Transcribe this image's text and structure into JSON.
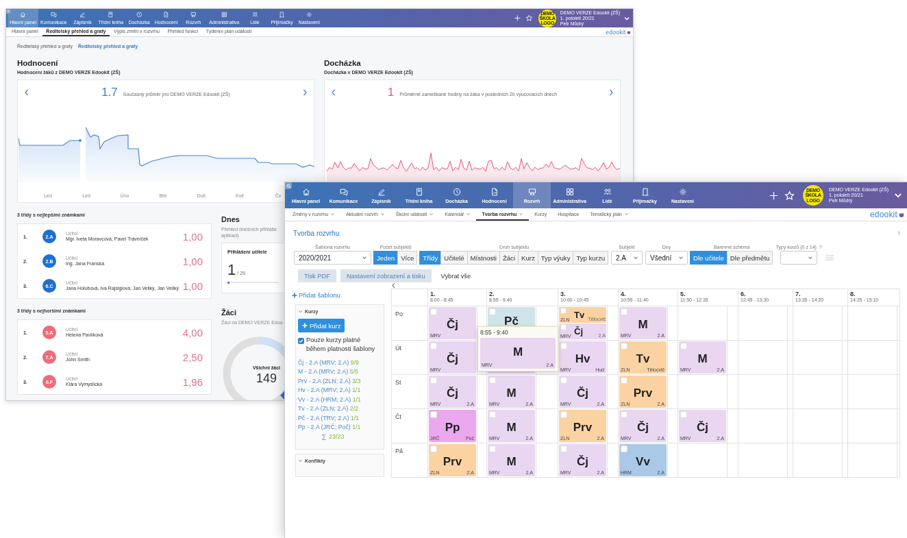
{
  "back_window": {
    "nav": {
      "items": [
        {
          "label": "Hlavní panel",
          "selected": true
        },
        {
          "label": "Komunikace",
          "selected": false
        },
        {
          "label": "Zápisník",
          "selected": false
        },
        {
          "label": "Třídní kniha",
          "selected": false
        },
        {
          "label": "Docházka",
          "selected": false
        },
        {
          "label": "Hodnocení",
          "selected": false
        },
        {
          "label": "Rozvrh",
          "selected": false
        },
        {
          "label": "Administrativa",
          "selected": false
        },
        {
          "label": "Lidé",
          "selected": false
        },
        {
          "label": "Přijímačky",
          "selected": false
        },
        {
          "label": "Nastavení",
          "selected": false
        }
      ],
      "logo": "DEMO ŠKOLA LOGO",
      "account": {
        "school": "DEMO VERZE Edookit (ZŠ)",
        "term": "1. pololetí 20/21",
        "user": "Petr Můdrý"
      }
    },
    "subnav": [
      {
        "label": "Hlavní panel",
        "selected": false
      },
      {
        "label": "Ředitelský přehled a grafy",
        "selected": true
      },
      {
        "label": "Výpis změn v rozvrhu",
        "selected": false
      },
      {
        "label": "Přehled funkcí",
        "selected": false
      },
      {
        "label": "Týdenní plán událostí",
        "selected": false
      }
    ],
    "brand": "edookit",
    "breadcrumb": [
      "Ředitelský přehled a grafy",
      "Ředitelský přehled a grafy"
    ],
    "grades": {
      "title": "Hodnocení",
      "subtitle": "Hodnocení žáků z DEMO VERZE Edookit (ZŠ)",
      "value": "1.7",
      "caption": "Současný průměr pro DEMO VERZE Edookit (ZŠ)",
      "month_labels": [
        "Led",
        "Led",
        "Úno",
        "Bře",
        "Dub",
        "Kvě",
        "Čv"
      ]
    },
    "attendance": {
      "title": "Docházka",
      "subtitle": "Docházka v DEMO VERZE Edookit (ZŠ)",
      "value": "1",
      "caption": "Průměrné zameškané hodiny na žáka v posledních 20 vyučovacích dnech"
    },
    "rankings": [
      {
        "kind": "best",
        "title": "3 třídy s nejlepšími známkami",
        "rows": [
          {
            "rank": "1.",
            "class": "2.A",
            "role": "Učitel",
            "teachers": "Mgr. Iveta Moravcová, Pavel Trávníček",
            "average": "1,00"
          },
          {
            "rank": "2.",
            "class": "2.B",
            "role": "Učitel",
            "teachers": "Ing. Jana Franská",
            "average": "1,00"
          },
          {
            "rank": "3.",
            "class": "6.C",
            "role": "Učitel",
            "teachers": "Jana Holubová, Iva Rajsiglová, Jan Veliký, Jan Veliký",
            "average": "1,00"
          }
        ]
      },
      {
        "kind": "worst",
        "title": "3 třídy s nejhoršími známkami",
        "rows": [
          {
            "rank": "1.",
            "class": "5.A",
            "role": "Učitel",
            "teachers": "Helena Pavlíková",
            "average": "4,00"
          },
          {
            "rank": "2.",
            "class": "7.A",
            "role": "Učitel",
            "teachers": "John Smith",
            "average": "2,50"
          },
          {
            "rank": "3.",
            "class": "6.F",
            "role": "Učitel",
            "teachers": "Klára Vymyslická",
            "average": "1,96"
          }
        ]
      }
    ],
    "today": {
      "title": "Dnes",
      "description": [
        "Přehled dnešních přihláše",
        "aplikaci)"
      ],
      "card": {
        "title": "Přihlášení učitelé",
        "value": "1",
        "total": "/ 29",
        "level": 0.04
      }
    },
    "students": {
      "title": "Žáci",
      "description": "Žáci na DEMO VERZE Edoo",
      "total_label": "Všichni žáci",
      "total": "149"
    }
  },
  "front_window": {
    "nav": {
      "items": [
        {
          "label": "Hlavní panel",
          "selected": false
        },
        {
          "label": "Komunikace",
          "selected": false
        },
        {
          "label": "Zápisník",
          "selected": false
        },
        {
          "label": "Třídní kniha",
          "selected": false
        },
        {
          "label": "Docházka",
          "selected": false
        },
        {
          "label": "Hodnocení",
          "selected": false
        },
        {
          "label": "Rozvrh",
          "selected": true
        },
        {
          "label": "Administrativa",
          "selected": false
        },
        {
          "label": "Lidé",
          "selected": false
        },
        {
          "label": "Přijímačky",
          "selected": false
        },
        {
          "label": "Nastavení",
          "selected": false
        }
      ],
      "logo": "DEMO ŠKOLA LOGO",
      "account": {
        "school": "DEMO VERZE Edookit (ZŠ)",
        "term": "1. pololetí 20/21",
        "user": "Petr Můdrý"
      }
    },
    "subnav": [
      {
        "label": "Změny v rozvrhu",
        "selected": false,
        "menu": true
      },
      {
        "label": "Aktuální rozvrh",
        "selected": false,
        "menu": true
      },
      {
        "label": "Školní události",
        "selected": false,
        "menu": true
      },
      {
        "label": "Kalendář",
        "selected": false,
        "menu": true
      },
      {
        "label": "Tvorba rozvrhu",
        "selected": true,
        "menu": true
      },
      {
        "label": "Kurzy",
        "selected": false,
        "menu": false
      },
      {
        "label": "Hospitace",
        "selected": false,
        "menu": false
      },
      {
        "label": "Tematický plán",
        "selected": false,
        "menu": true
      }
    ],
    "brand": "edookit",
    "title": "Tvorba rozvrhu",
    "help": "?",
    "toolbar": [
      {
        "kind": "select",
        "label": "Šablona rozvrhu",
        "value": "2020/2021"
      },
      {
        "kind": "toggle",
        "label": "Počet subjektů",
        "options": [
          {
            "label": "Jeden",
            "selected": true
          },
          {
            "label": "Více",
            "selected": false
          }
        ]
      },
      {
        "kind": "toggle",
        "label": "Druh subjektu",
        "options": [
          {
            "label": "Třídy",
            "selected": true
          },
          {
            "label": "Učitelé",
            "selected": false
          },
          {
            "label": "Místnosti",
            "selected": false
          },
          {
            "label": "Žáci",
            "selected": false
          },
          {
            "label": "Kurz",
            "selected": false
          },
          {
            "label": "Typ výuky",
            "selected": false
          },
          {
            "label": "Typ kurzu",
            "selected": false
          }
        ]
      },
      {
        "kind": "select",
        "label": "Subjekt",
        "value": "2.A"
      },
      {
        "kind": "select",
        "label": "Dny",
        "value": "Všední"
      },
      {
        "kind": "toggle",
        "label": "Barevné schéma",
        "options": [
          {
            "label": "Dle učitele",
            "selected": true
          },
          {
            "label": "Dle předmětu",
            "selected": false
          }
        ]
      },
      {
        "kind": "select",
        "label": "Typy kurzů (0 z 14)",
        "help": "?"
      }
    ],
    "actions": [
      {
        "kind": "button",
        "label": "Tisk PDF"
      },
      {
        "kind": "button",
        "label": "Nastavení zobrazení a tisku"
      },
      {
        "kind": "link",
        "label": "Vybrat vše"
      }
    ],
    "side": {
      "add_template": "Přidat šablonu",
      "courses_title": "Kurzy",
      "add_course": "Přidat kurz",
      "filter": {
        "label": "Pouze kurzy platné během platnosti šablony",
        "checked": true
      },
      "courses": [
        {
          "name": "Čj - 2.A (MRV; 2.A)",
          "count": "9/9"
        },
        {
          "name": "M - 2.A (MRV; 2.A)",
          "count": "5/5"
        },
        {
          "name": "Prv - 2.A (ZLN; 2.A)",
          "count": "3/3"
        },
        {
          "name": "Hv - 2.A (MRV; 2.A)",
          "count": "1/1"
        },
        {
          "name": "Vv - 2.A (HRM; 2.A)",
          "count": "1/1"
        },
        {
          "name": "Tv - 2.A (ZLN; 2.A)",
          "count": "2/2"
        },
        {
          "name": "Pč - 2.A (TRV; 2.A)",
          "count": "1/1"
        },
        {
          "name": "Pp - 2.A (JRČ; Poč)",
          "count": "1/1"
        }
      ],
      "sum_symbol": "∑",
      "sum": "23/23",
      "conflicts_title": "Konflikty"
    },
    "periods": [
      {
        "number": "1.",
        "time": "8:00 - 8:45"
      },
      {
        "number": "2.",
        "time": "8:55 - 9:40"
      },
      {
        "number": "3.",
        "time": "10:00 - 10:45"
      },
      {
        "number": "4.",
        "time": "10:55 - 11:40"
      },
      {
        "number": "5.",
        "time": "11:50 - 12:35"
      },
      {
        "number": "6.",
        "time": "12:45 - 13:30"
      },
      {
        "number": "7.",
        "time": "13:35 - 14:20"
      },
      {
        "number": "8.",
        "time": "14:25 - 15:10"
      }
    ],
    "days": [
      {
        "name": "Po",
        "slots": [
          {
            "kind": "lesson",
            "subject": "Čj",
            "teacher": "MRV",
            "color": "#e9d6f1",
            "checked": false
          },
          {
            "kind": "lesson",
            "subject": "Pč",
            "color": "#cfe4ea",
            "checked": false
          },
          {
            "kind": "split",
            "lessons": [
              {
                "subject": "Tv",
                "teacher": "ZLN",
                "room": "Tělocvič",
                "color": "#fbd2a2",
                "checked": false
              },
              {
                "subject": "Čj",
                "teacher": "MRV",
                "room": "2.A",
                "color": "#e9d6f1",
                "checked": false
              }
            ]
          },
          {
            "kind": "lesson",
            "subject": "M",
            "teacher": "MRV",
            "room": "2.A",
            "color": "#e9d6f1",
            "checked": false
          },
          {
            "kind": "empty"
          },
          {
            "kind": "empty"
          },
          {
            "kind": "empty"
          },
          {
            "kind": "empty"
          }
        ]
      },
      {
        "name": "Út",
        "slots": [
          {
            "kind": "lesson",
            "subject": "Čj",
            "teacher": "MRV",
            "color": "#e9d6f1",
            "checked": false
          },
          {
            "kind": "lesson",
            "color": "#e9d6f1"
          },
          {
            "kind": "lesson",
            "subject": "Hv",
            "teacher": "MRV",
            "room": "Hud",
            "color": "#e9d6f1",
            "checked": false
          },
          {
            "kind": "lesson",
            "subject": "Tv",
            "teacher": "ZLN",
            "room": "Tělocvič",
            "color": "#fbd2a2",
            "checked": false
          },
          {
            "kind": "lesson",
            "subject": "M",
            "teacher": "MRV",
            "room": "2.A",
            "color": "#e9d6f1",
            "checked": false
          },
          {
            "kind": "empty"
          },
          {
            "kind": "empty"
          },
          {
            "kind": "empty"
          }
        ]
      },
      {
        "name": "St",
        "slots": [
          {
            "kind": "lesson",
            "subject": "Čj",
            "teacher": "MRV",
            "room": "2.A",
            "color": "#e9d6f1",
            "checked": false
          },
          {
            "kind": "lesson",
            "subject": "M",
            "teacher": "MRV",
            "room": "2.A",
            "color": "#e9d6f1",
            "checked": false
          },
          {
            "kind": "lesson",
            "subject": "Čj",
            "teacher": "MRV",
            "room": "2.A",
            "color": "#e9d6f1",
            "checked": false
          },
          {
            "kind": "lesson",
            "subject": "Prv",
            "teacher": "ZLN",
            "room": "2.A",
            "color": "#fbd2a2",
            "checked": false
          },
          {
            "kind": "empty"
          },
          {
            "kind": "empty"
          },
          {
            "kind": "empty"
          },
          {
            "kind": "empty"
          }
        ]
      },
      {
        "name": "Čt",
        "slots": [
          {
            "kind": "lesson",
            "subject": "Pp",
            "teacher": "JRČ",
            "room": "Poč",
            "color": "#eaa8ee",
            "checked": false
          },
          {
            "kind": "lesson",
            "subject": "M",
            "teacher": "MRV",
            "room": "2.A",
            "color": "#e9d6f1",
            "checked": false
          },
          {
            "kind": "lesson",
            "subject": "Prv",
            "teacher": "ZLN",
            "room": "2.A",
            "color": "#fbd2a2",
            "checked": false
          },
          {
            "kind": "lesson",
            "subject": "Čj",
            "teacher": "MRV",
            "room": "2.A",
            "color": "#e9d6f1",
            "checked": false
          },
          {
            "kind": "lesson",
            "subject": "Čj",
            "teacher": "MRV",
            "room": "2.A",
            "color": "#e9d6f1",
            "checked": false
          },
          {
            "kind": "empty"
          },
          {
            "kind": "empty"
          },
          {
            "kind": "empty"
          }
        ]
      },
      {
        "name": "Pá",
        "slots": [
          {
            "kind": "lesson",
            "subject": "Prv",
            "teacher": "ZLN",
            "room": "2.A",
            "color": "#fbd2a2",
            "checked": false
          },
          {
            "kind": "lesson",
            "subject": "M",
            "teacher": "MRV",
            "room": "2.A",
            "color": "#e9d6f1",
            "checked": false
          },
          {
            "kind": "lesson",
            "subject": "Čj",
            "teacher": "MRV",
            "room": "2.A",
            "color": "#e9d6f1",
            "checked": false
          },
          {
            "kind": "lesson",
            "subject": "Vv",
            "teacher": "HRM",
            "room": "2.A",
            "color": "#a9c9e6",
            "checked": false
          },
          {
            "kind": "empty"
          },
          {
            "kind": "empty"
          },
          {
            "kind": "empty"
          },
          {
            "kind": "empty"
          }
        ]
      }
    ],
    "tooltip": {
      "time": "8:55 - 9:40",
      "subject": "M",
      "teacher": "MRV",
      "room": "2.A",
      "color": "#e9d6f1"
    }
  }
}
